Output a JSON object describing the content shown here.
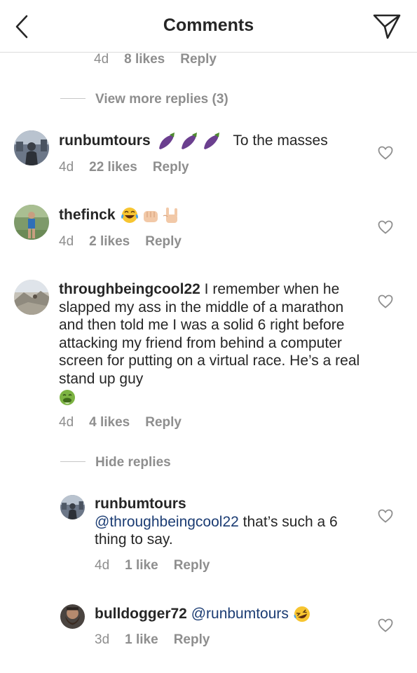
{
  "header": {
    "title": "Comments",
    "back_icon": "chevron-left-icon",
    "send_icon": "paper-plane-icon"
  },
  "top_partial": {
    "time": "4d",
    "likes": "8 likes",
    "reply": "Reply"
  },
  "view_more": {
    "label": "View more replies (3)"
  },
  "comments": [
    {
      "username": "runbumtours",
      "text_after": "To the masses",
      "time": "4d",
      "likes": "22 likes",
      "reply": "Reply"
    },
    {
      "username": "thefinck",
      "time": "4d",
      "likes": "2 likes",
      "reply": "Reply"
    },
    {
      "username": "throughbeingcool22",
      "text": "I remember when he slapped my ass in the middle of a marathon and then told me I was a solid 6 right before attacking my friend from behind a computer screen for putting on a virtual race. He’s a real stand up guy",
      "time": "4d",
      "likes": "4 likes",
      "reply": "Reply"
    }
  ],
  "hide_replies": {
    "label": "Hide replies"
  },
  "replies": [
    {
      "username": "runbumtours",
      "mention": "@throughbeingcool22",
      "text": "that’s such a 6 thing to say.",
      "time": "4d",
      "likes": "1 like",
      "reply": "Reply"
    },
    {
      "username": "bulldogger72",
      "mention": "@runbumtours",
      "time": "3d",
      "likes": "1 like",
      "reply": "Reply"
    }
  ],
  "colors": {
    "text": "#262626",
    "secondary": "#8e8e8e",
    "mention": "#1b3c73",
    "divider": "#dbdbdb"
  }
}
